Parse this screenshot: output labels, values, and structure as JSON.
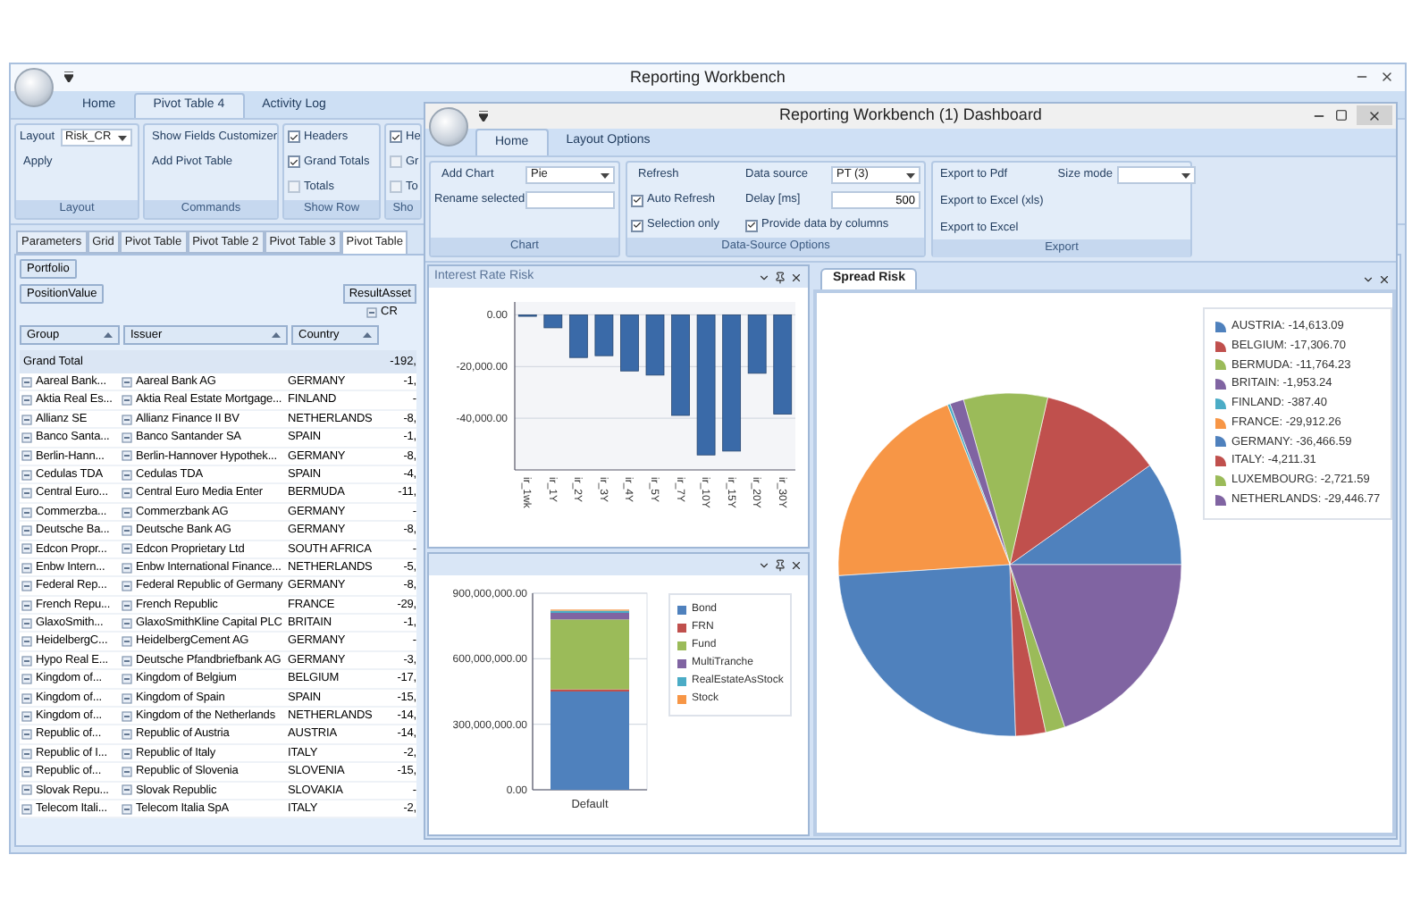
{
  "main_window": {
    "title": "Reporting Workbench",
    "tabs": [
      {
        "label": "Home",
        "selected": false
      },
      {
        "label": "Pivot Table 4",
        "selected": true
      },
      {
        "label": "Activity Log",
        "selected": false
      }
    ],
    "ribbon": {
      "layout_group": {
        "label": "Layout",
        "field_label": "Layout",
        "select_value": "Risk_CR",
        "apply": "Apply"
      },
      "commands_group": {
        "label": "Commands",
        "buttons": [
          "Show Fields Customizer",
          "Add Pivot Table"
        ]
      },
      "show_row_group": {
        "label": "Show Row",
        "checkboxes": [
          {
            "label": "Headers",
            "checked": true
          },
          {
            "label": "Grand Totals",
            "checked": true
          },
          {
            "label": "Totals",
            "checked": false
          }
        ]
      },
      "group_4": {
        "label": "Sho",
        "checkboxes": [
          {
            "label": "He",
            "checked": true
          },
          {
            "label": "Gr",
            "checked": false
          },
          {
            "label": "To",
            "checked": false
          }
        ]
      }
    },
    "document_tabs": [
      {
        "label": "Parameters",
        "selected": false
      },
      {
        "label": "Grid",
        "selected": false
      },
      {
        "label": "Pivot Table",
        "selected": false
      },
      {
        "label": "Pivot Table 2",
        "selected": false
      },
      {
        "label": "Pivot Table 3",
        "selected": false
      },
      {
        "label": "Pivot Table",
        "selected": true
      }
    ],
    "pivot": {
      "filter_field": "Portfolio",
      "data_field": "PositionValue",
      "column_field": "ResultAsset",
      "column_value": "CR",
      "row_headers": [
        "Group",
        "Issuer",
        "Country"
      ],
      "grand_total": {
        "label": "Grand Total",
        "value": "-192,"
      },
      "rows": [
        {
          "group": "Aareal Bank...",
          "issuer": "Aareal Bank AG",
          "country": "GERMANY",
          "value": "-1,"
        },
        {
          "group": "Aktia Real Es...",
          "issuer": "Aktia Real Estate Mortgage...",
          "country": "FINLAND",
          "value": "-"
        },
        {
          "group": "Allianz SE",
          "issuer": "Allianz Finance II BV",
          "country": "NETHERLANDS",
          "value": "-8,"
        },
        {
          "group": "Banco Santa...",
          "issuer": "Banco Santander SA",
          "country": "SPAIN",
          "value": "-1,"
        },
        {
          "group": "Berlin-Hann...",
          "issuer": "Berlin-Hannover Hypothek...",
          "country": "GERMANY",
          "value": "-8,"
        },
        {
          "group": "Cedulas TDA",
          "issuer": "Cedulas TDA",
          "country": "SPAIN",
          "value": "-4,"
        },
        {
          "group": "Central Euro...",
          "issuer": "Central Euro Media Enter",
          "country": "BERMUDA",
          "value": "-11,"
        },
        {
          "group": "Commerzba...",
          "issuer": "Commerzbank AG",
          "country": "GERMANY",
          "value": "-"
        },
        {
          "group": "Deutsche Ba...",
          "issuer": "Deutsche Bank AG",
          "country": "GERMANY",
          "value": "-8,"
        },
        {
          "group": "Edcon Propr...",
          "issuer": "Edcon Proprietary Ltd",
          "country": "SOUTH AFRICA",
          "value": "-"
        },
        {
          "group": "Enbw Intern...",
          "issuer": "Enbw International Finance...",
          "country": "NETHERLANDS",
          "value": "-5,"
        },
        {
          "group": "Federal Rep...",
          "issuer": "Federal Republic of Germany",
          "country": "GERMANY",
          "value": "-8,"
        },
        {
          "group": "French Repu...",
          "issuer": "French Republic",
          "country": "FRANCE",
          "value": "-29,"
        },
        {
          "group": "GlaxoSmith...",
          "issuer": "GlaxoSmithKline Capital PLC",
          "country": "BRITAIN",
          "value": "-1,"
        },
        {
          "group": "HeidelbergC...",
          "issuer": "HeidelbergCement AG",
          "country": "GERMANY",
          "value": "-"
        },
        {
          "group": "Hypo Real E...",
          "issuer": "Deutsche Pfandbriefbank AG",
          "country": "GERMANY",
          "value": "-3,"
        },
        {
          "group": "Kingdom of...",
          "issuer": "Kingdom of Belgium",
          "country": "BELGIUM",
          "value": "-17,"
        },
        {
          "group": "Kingdom of...",
          "issuer": "Kingdom of Spain",
          "country": "SPAIN",
          "value": "-15,"
        },
        {
          "group": "Kingdom of...",
          "issuer": "Kingdom of the Netherlands",
          "country": "NETHERLANDS",
          "value": "-14,"
        },
        {
          "group": "Republic of...",
          "issuer": "Republic of Austria",
          "country": "AUSTRIA",
          "value": "-14,"
        },
        {
          "group": "Republic of I...",
          "issuer": "Republic of Italy",
          "country": "ITALY",
          "value": "-2,"
        },
        {
          "group": "Republic of...",
          "issuer": "Republic of Slovenia",
          "country": "SLOVENIA",
          "value": "-15,"
        },
        {
          "group": "Slovak Repu...",
          "issuer": "Slovak Republic",
          "country": "SLOVAKIA",
          "value": "-"
        },
        {
          "group": "Telecom Itali...",
          "issuer": "Telecom Italia SpA",
          "country": "ITALY",
          "value": "-2,"
        }
      ]
    }
  },
  "dashboard": {
    "title": "Reporting Workbench (1) Dashboard",
    "tabs": [
      {
        "label": "Home",
        "selected": true
      },
      {
        "label": "Layout Options",
        "selected": false
      }
    ],
    "ribbon": {
      "chart_group": {
        "label": "Chart",
        "add_chart_label": "Add Chart",
        "add_chart_value": "Pie",
        "rename_label": "Rename selected"
      },
      "data_source_group": {
        "label": "Data-Source Options",
        "refresh": "Refresh",
        "auto_refresh": {
          "label": "Auto Refresh",
          "checked": true
        },
        "selection_only": {
          "label": "Selection only",
          "checked": true
        },
        "data_source_label": "Data source",
        "data_source_value": "PT (3)",
        "delay_label": "Delay [ms]",
        "delay_value": "500",
        "by_columns": {
          "label": "Provide data by columns",
          "checked": true
        }
      },
      "export_group": {
        "label": "Export",
        "buttons": [
          "Export to Pdf",
          "Export to Excel (xls)",
          "Export to Excel"
        ],
        "size_mode_label": "Size mode"
      }
    },
    "interest_rate_panel": {
      "title": "Interest Rate Risk",
      "chart_data": {
        "type": "bar",
        "grid": true,
        "categories": [
          "ir_1wk",
          "ir_1Y",
          "ir_2Y",
          "ir_3Y",
          "ir_4Y",
          "ir_5Y",
          "ir_7Y",
          "ir_10Y",
          "ir_15Y",
          "ir_20Y",
          "ir_30Y"
        ],
        "values": [
          -300,
          -5000,
          -16500,
          -15800,
          -21700,
          -23300,
          -38900,
          -54200,
          -52700,
          -22600,
          -38400
        ],
        "ylim": [
          -60000,
          5000
        ],
        "yticks": [
          {
            "value": 0,
            "label": "0.00"
          },
          {
            "value": -20000,
            "label": "-20,000.00"
          },
          {
            "value": -40000,
            "label": "-40,000.00"
          }
        ]
      }
    },
    "asset_panel": {
      "chart_data": {
        "type": "bar",
        "stacked": true,
        "categories": [
          "Default"
        ],
        "series": [
          {
            "name": "Bond",
            "color": "#4f81bd",
            "values": [
              450000000
            ]
          },
          {
            "name": "FRN",
            "color": "#c0504d",
            "values": [
              10000000
            ]
          },
          {
            "name": "Fund",
            "color": "#9bbb59",
            "values": [
              320000000
            ]
          },
          {
            "name": "MultiTranche",
            "color": "#8064a2",
            "values": [
              30000000
            ]
          },
          {
            "name": "RealEstateAsStock",
            "color": "#4bacc6",
            "values": [
              10000000
            ]
          },
          {
            "name": "Stock",
            "color": "#f79646",
            "values": [
              5000000
            ]
          }
        ],
        "grid": true,
        "ylim": [
          0,
          900000000
        ],
        "yticks": [
          {
            "value": 0,
            "label": "0.00"
          },
          {
            "value": 300000000,
            "label": "300,000,000.00"
          },
          {
            "value": 600000000,
            "label": "600,000,000.00"
          },
          {
            "value": 900000000,
            "label": "900,000,000.00"
          }
        ]
      }
    },
    "spread_panel": {
      "tab_label": "Spread Risk",
      "chart_data": {
        "type": "pie",
        "categories": [
          "AUSTRIA: -14,613.09",
          "BELGIUM: -17,306.70",
          "BERMUDA: -11,764.23",
          "BRITAIN: -1,953.24",
          "FINLAND: -387.40",
          "FRANCE: -29,912.26",
          "GERMANY: -36,466.59",
          "ITALY: -4,211.31",
          "LUXEMBOURG: -2,721.59",
          "NETHERLANDS: -29,446.77"
        ],
        "values": [
          9.82,
          11.63,
          7.91,
          1.31,
          0.26,
          20.1,
          24.51,
          2.83,
          1.83,
          19.8
        ],
        "colors": [
          "#4f81bd",
          "#c0504d",
          "#9bbb59",
          "#8064a2",
          "#4bacc6",
          "#f79646",
          "#4f81bd",
          "#c0504d",
          "#9bbb59",
          "#8064a2"
        ]
      }
    }
  }
}
